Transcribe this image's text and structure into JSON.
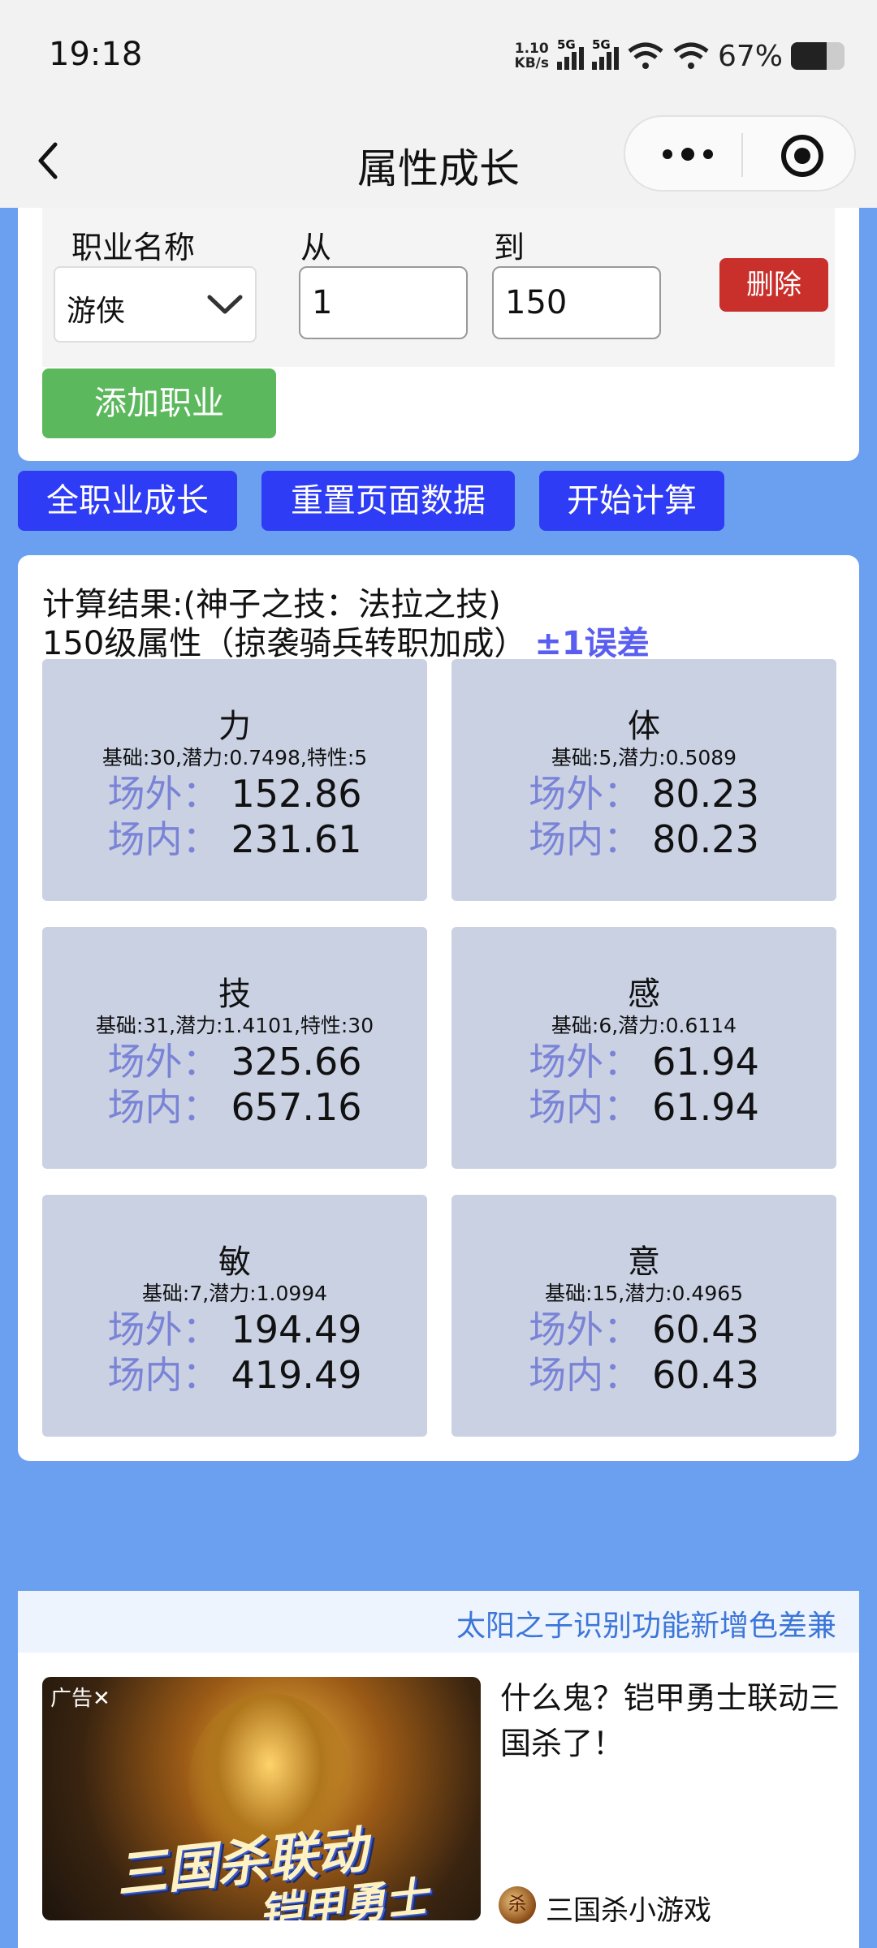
{
  "status_bar": {
    "time": "19:18",
    "net_speed_value": "1.10",
    "net_speed_unit": "KB/s",
    "signal1_tag": "5G",
    "signal2_tag": "5G",
    "battery_percent": "67%",
    "battery_level": 0.67
  },
  "nav": {
    "title": "属性成长"
  },
  "job_form": {
    "job_label": "职业名称",
    "from_label": "从",
    "to_label": "到",
    "job_value": "游侠",
    "from_value": "1",
    "to_value": "150",
    "delete_label": "删除",
    "add_label": "添加职业"
  },
  "actions": {
    "all_growth": "全职业成长",
    "reset": "重置页面数据",
    "calculate": "开始计算"
  },
  "result": {
    "line1": "计算结果:(神子之技：法拉之技)",
    "line2": "150级属性（掠袭骑兵转职加成）",
    "error": "±1误差",
    "out_label": "场外：",
    "in_label": "场内：",
    "stats": [
      {
        "name": "力",
        "base": "基础:30,潜力:0.7498,特性:5",
        "outside": "152.86",
        "inside": "231.61"
      },
      {
        "name": "体",
        "base": "基础:5,潜力:0.5089",
        "outside": "80.23",
        "inside": "80.23"
      },
      {
        "name": "技",
        "base": "基础:31,潜力:1.4101,特性:30",
        "outside": "325.66",
        "inside": "657.16"
      },
      {
        "name": "感",
        "base": "基础:6,潜力:0.6114",
        "outside": "61.94",
        "inside": "61.94"
      },
      {
        "name": "敏",
        "base": "基础:7,潜力:1.0994",
        "outside": "194.49",
        "inside": "419.49"
      },
      {
        "name": "意",
        "base": "基础:15,潜力:0.4965",
        "outside": "60.43",
        "inside": "60.43"
      }
    ]
  },
  "marquee": {
    "text": "太阳之子识别功能新增色差兼"
  },
  "ad": {
    "image_mark": "广告✕",
    "image_text1": "三国杀联动",
    "image_text2": "铠甲勇士了!",
    "title": "什么鬼？铠甲勇士联动三国杀了！",
    "source_icon_char": "杀",
    "source": "三国杀小游戏"
  }
}
